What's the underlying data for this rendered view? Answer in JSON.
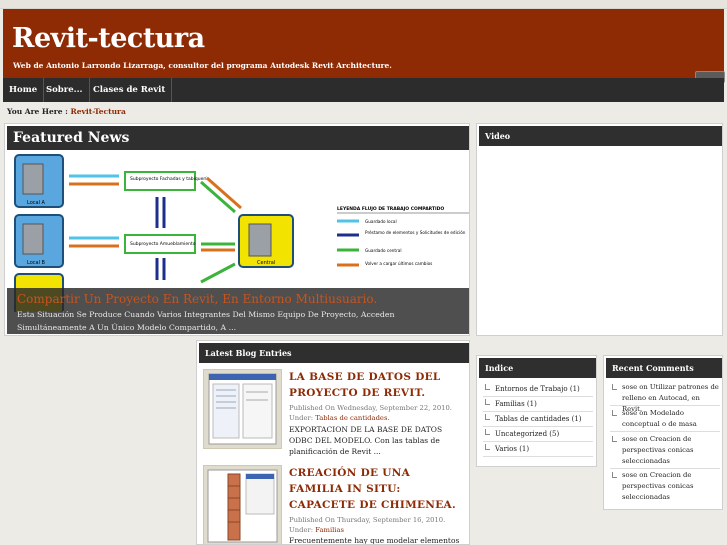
{
  "site": {
    "title": "Revit-tectura",
    "description": "Web de Antonio Larrondo Lizarraga, consultor del programa Autodesk Revit Architecture."
  },
  "nav": {
    "items": [
      "Home",
      "Sobre...",
      "Clases de Revit"
    ]
  },
  "breadcrumb": {
    "prefix": "You Are Here :",
    "current": "Revit-Tectura"
  },
  "featured": {
    "heading": "Featured News",
    "diagram": {
      "box1": "Local A",
      "box2": "Local B",
      "box3": "Central",
      "sub1": "Subproyecto Fachadas y tabiquería",
      "sub2": "Subproyecto Amueblamiento",
      "legend_title": "LEYENDA FLUJO DE TRABAJO COMPARTIDO",
      "legend": [
        "Guardado local",
        "Préstamo de elementos y Solicitudes de edición",
        "Guardado central",
        "Volver a cargar últimos cambios"
      ]
    },
    "caption_title": "Compartir Un Proyecto En Revit, En Entorno Multiusuario.",
    "caption_text": "Esta Situación Se Produce Cuando Varios Integrantes Del Mismo Equipo De Proyecto, Acceden Simultáneamente A Un Único Modelo Compartido, A ..."
  },
  "video": {
    "heading": "Video"
  },
  "blog": {
    "heading": "Latest Blog Entries",
    "entries": [
      {
        "title": "LA BASE DE DATOS DEL PROYECTO DE REVIT.",
        "meta": "Published On Wednesday, September 22, 2010. Under:",
        "category": "Tablas de cantidades.",
        "excerpt": "EXPORTACION DE LA BASE DE DATOS ODBC DEL MODELO.  Con las tablas de planificación de Revit ..."
      },
      {
        "title": "CREACIÓN DE UNA FAMILIA IN SITU: CAPACETE DE CHIMENEA.",
        "meta": "Published On Thursday, September 16, 2010. Under:",
        "category": "Familias",
        "excerpt": "Frecuentemente hay que modelar elementos"
      }
    ]
  },
  "indice": {
    "heading": "Indice",
    "items": [
      "Entornos de Trabajo (1)",
      "Familias (1)",
      "Tablas de cantidades (1)",
      "Uncategorized (5)",
      "Varios (1)"
    ]
  },
  "recent": {
    "heading": "Recent Comments",
    "items": [
      {
        "author": "sose",
        "on": " on ",
        "post": "Utilizar patrones de relleno en Autocad, en Revit."
      },
      {
        "author": "sose",
        "on": " on ",
        "post": "Modelado conceptual o de masa"
      },
      {
        "author": "sose",
        "on": " on ",
        "post": "Creacion de perspectivas conicas seleccionadas"
      },
      {
        "author": "sose",
        "on": " on ",
        "post": "Creacion de perspectivas conicas seleccionadas"
      }
    ]
  },
  "colors": {
    "header": "#8e2a04",
    "nav": "#2c2c2c",
    "panel": "#2f2f2f",
    "link": "#8e2a04"
  }
}
